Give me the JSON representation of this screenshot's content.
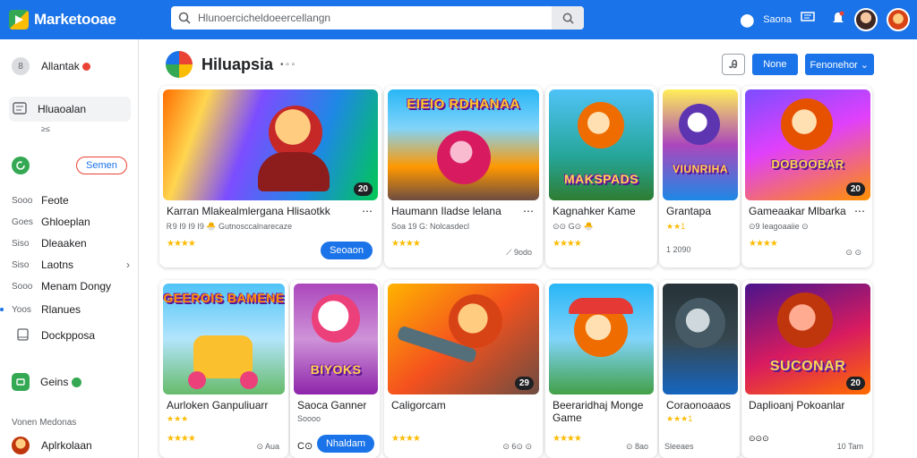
{
  "header": {
    "brand": "Marketooae",
    "search_placeholder": "Hlunoercicheldoeercellangn",
    "right_label": "Saona"
  },
  "sidebar": {
    "account_name": "Allantak",
    "account_initial": "8",
    "selected_item": "Hluaoalan",
    "selected_sub": "≥≤",
    "action_button": "Semen",
    "items": [
      {
        "prefix": "Sooo",
        "label": "Feote"
      },
      {
        "prefix": "Goes",
        "label": "Ghloeplan"
      },
      {
        "prefix": "Siso",
        "label": "Dleaaken"
      },
      {
        "prefix": "Siso",
        "label": "Laotns"
      },
      {
        "prefix": "Sooo",
        "label": "Menam Dongy"
      },
      {
        "prefix": "Yoos",
        "label": "Rlanues"
      },
      {
        "prefix": "",
        "label": "Dockpposa"
      }
    ],
    "games_label": "Geins",
    "section_label": "Vonen Medonas",
    "bottom_user": "Aplrkolaan"
  },
  "main": {
    "title": "Hiluapsia",
    "title_suffix": "• ▫ ▫",
    "btn_primary": "None",
    "btn_dropdown": "Fenonehor ⌄"
  },
  "cards_row1": [
    {
      "title": "Karran Mlakealmlergana Hlisaotkk",
      "sub": "Ꭱ9 I9 I9 I9 🐣 Gutnosccalnarecaze",
      "stars": "★★★★",
      "badge": "20",
      "action": "Seoaon",
      "thumb_text": ""
    },
    {
      "title": "Haumann Iladse lelana",
      "sub": "Soa 19 G: Nolcasdecl",
      "stars": "★★★★",
      "badge": "",
      "meta": "⟋ 9odo",
      "thumb_text": "EIEIO RDHANAA"
    },
    {
      "title": "Kagnahker Kame",
      "sub": "⊙⊙ G⊙ 🐣",
      "stars": "★★★★",
      "badge": "",
      "meta": "",
      "thumb_text": "MAKSPADS"
    },
    {
      "title": "Grantapa",
      "sub": "★★1",
      "stars": "",
      "badge": "",
      "meta": "1 2090",
      "thumb_text": "VIUNRIHA"
    },
    {
      "title": "Gameaakar Mlbarka",
      "sub": "⊙9 Ieagoaaiie ⊙",
      "stars": "★★★★",
      "badge": "20",
      "meta": "⊙ ⊙",
      "thumb_text": "DOBOOBAR"
    }
  ],
  "cards_row2": [
    {
      "title": "Aurloken Ganpuliuarr",
      "sub": "★★★",
      "stars": "★★★★",
      "badge": "",
      "meta": "⊙ Aua",
      "thumb_text": "GEEROIS BAMENE"
    },
    {
      "title": "Saoca Ganner",
      "sub": "Soooo",
      "stars": "",
      "badge": "",
      "meta": "C⊙",
      "action": "Nhaldam",
      "thumb_text": "BIYOKS"
    },
    {
      "title": "Caligorcam",
      "sub": "",
      "stars": "★★★★",
      "badge": "29",
      "meta": "⊙ 6⊙ ⊙",
      "thumb_text": ""
    },
    {
      "title": "Beeraridhaj Monge Game",
      "sub": "",
      "stars": "★★★★",
      "badge": "",
      "meta": "⊙ 8ao",
      "thumb_text": ""
    },
    {
      "title": "Coraonoaaos",
      "sub": "★★★1",
      "stars": "",
      "badge": "",
      "meta": "Sleeaes",
      "thumb_text": ""
    },
    {
      "title": "Daplioanj Pokoanlar",
      "sub": "",
      "stars": "",
      "badge": "20",
      "meta": "10 Tam",
      "meta2": "⊙⊙⊙",
      "thumb_text": "SUCONAR"
    }
  ]
}
